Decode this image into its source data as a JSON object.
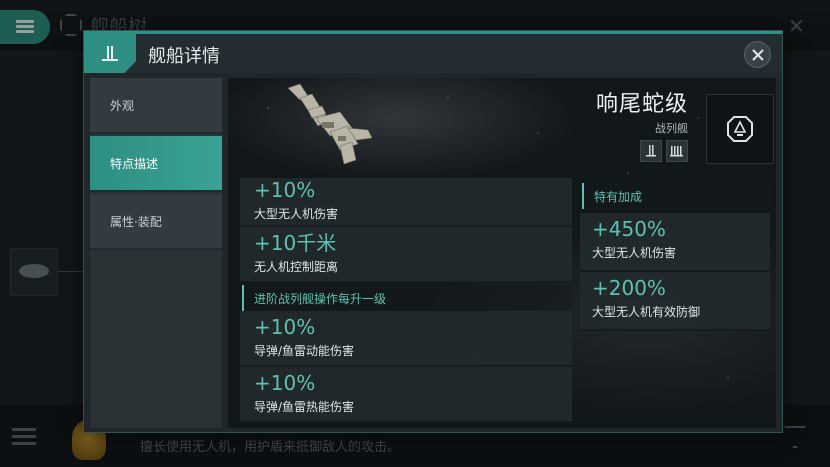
{
  "background": {
    "title": "舰船树",
    "bottom_text": "擅长使用无人机，用护盾来抵御敌人的攻击。"
  },
  "modal": {
    "title": "舰船详情",
    "tabs": [
      {
        "label": "外观",
        "active": false
      },
      {
        "label": "特点描述",
        "active": true
      },
      {
        "label": "属性·装配",
        "active": false
      }
    ],
    "ship": {
      "name": "响尾蛇级",
      "class": "战列舰"
    },
    "bonuses_top": [
      {
        "value": "+10%",
        "desc": "大型无人机伤害"
      },
      {
        "value": "+10千米",
        "desc": "无人机控制距离"
      }
    ],
    "section_advanced": "进阶战列舰操作每升一级",
    "bonuses_advanced": [
      {
        "value": "+10%",
        "desc": "导弹/鱼雷动能伤害"
      },
      {
        "value": "+10%",
        "desc": "导弹/鱼雷热能伤害"
      }
    ],
    "section_special": "特有加成",
    "bonuses_special": [
      {
        "value": "+450%",
        "desc": "大型无人机伤害"
      },
      {
        "value": "+200%",
        "desc": "大型无人机有效防御"
      }
    ]
  },
  "colors": {
    "accent": "#2e8f82",
    "bonus_value": "#5fc0b0"
  },
  "icons": [
    "menu-icon",
    "ship-tree-icon",
    "close-icon",
    "battleship-role-icon",
    "drone-role-icon",
    "faction-icon",
    "filter-icon"
  ]
}
